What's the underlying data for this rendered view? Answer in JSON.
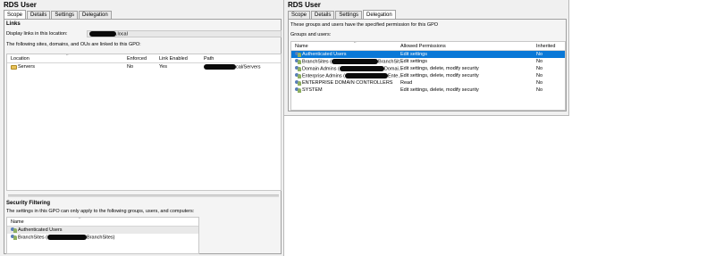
{
  "left": {
    "title": "RDS User",
    "tabs": [
      "Scope",
      "Details",
      "Settings",
      "Delegation"
    ],
    "links": {
      "heading": "Links",
      "display_label": "Display links in this location:",
      "display_value_suffix": ".local",
      "sites_label": "The following sites, domains, and OUs are linked to this GPO:",
      "columns": [
        "Location",
        "Enforced",
        "Link Enabled",
        "Path"
      ],
      "rows": [
        {
          "location": "Servers",
          "enforced": "No",
          "link_enabled": "Yes",
          "path_suffix": "cal/Servers"
        }
      ]
    },
    "security": {
      "heading": "Security Filtering",
      "desc": "The settings in this GPO can only apply to the following groups, users, and computers:",
      "columns": [
        "Name"
      ],
      "rows": [
        {
          "prefix": "Authenticated Users",
          "suffix": ""
        },
        {
          "prefix": "BranchSites (",
          "suffix": "BranchSites)"
        }
      ]
    }
  },
  "right": {
    "title": "RDS User",
    "tabs": [
      "Scope",
      "Details",
      "Settings",
      "Delegation"
    ],
    "desc": "These groups and users have the specified permission for this GPO",
    "groups_label": "Groups and users:",
    "columns": [
      "Name",
      "Allowed Permissions",
      "Inherited"
    ],
    "rows": [
      {
        "prefix": "Authenticated Users",
        "suffix": "",
        "permission": "Edit settings",
        "inherited": "No"
      },
      {
        "prefix": "BranchSites (",
        "suffix": "BranchSit...",
        "permission": "Edit settings",
        "inherited": "No"
      },
      {
        "prefix": "Domain Admins (",
        "suffix": "Domai...",
        "permission": "Edit settings, delete, modify security",
        "inherited": "No"
      },
      {
        "prefix": "Enterprise Admins (",
        "suffix": "Ente...",
        "permission": "Edit settings, delete, modify security",
        "inherited": "No"
      },
      {
        "prefix": "ENTERPRISE DOMAIN CONTROLLERS",
        "suffix": "",
        "permission": "Read",
        "inherited": "No"
      },
      {
        "prefix": "SYSTEM",
        "suffix": "",
        "permission": "Edit settings, delete, modify security",
        "inherited": "No"
      }
    ]
  },
  "colors": {
    "selection": "#0a78d7",
    "redaction": "#0a0a0a"
  }
}
